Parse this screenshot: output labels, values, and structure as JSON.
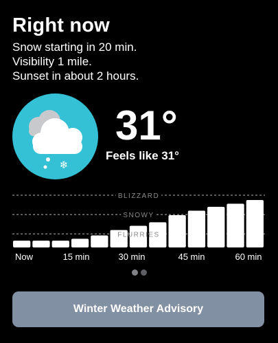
{
  "header": {
    "title": "Right now"
  },
  "summary": [
    "Snow starting in 20 min.",
    "Visibility 1 mile.",
    "Sunset in about 2 hours."
  ],
  "current": {
    "icon": "snow-cloud-icon",
    "temperature": "31°",
    "feels_like": "Feels like 31°"
  },
  "chart_data": {
    "type": "bar",
    "title": "",
    "levels": [
      "FLURRIES",
      "SNOWY",
      "BLIZZARD"
    ],
    "x_tick_labels": [
      "Now",
      "15 min",
      "30 min",
      "45 min",
      "60 min"
    ],
    "values": [
      0.35,
      0.35,
      0.35,
      0.45,
      0.62,
      0.9,
      1.12,
      1.3,
      1.67,
      1.9,
      2.1,
      2.26,
      2.45
    ],
    "ylim": [
      0,
      2.7
    ],
    "grid": true,
    "colors": {
      "bars": "#ffffff",
      "gridlines": "#b5b5b5",
      "level_text": "#8a8a8a"
    }
  },
  "pager": {
    "pages": 2,
    "active": 0
  },
  "advisory": {
    "label": "Winter Weather Advisory",
    "color": "#8290a3"
  },
  "theme": {
    "background": "#000000",
    "icon_circle": "#34c1d6"
  }
}
